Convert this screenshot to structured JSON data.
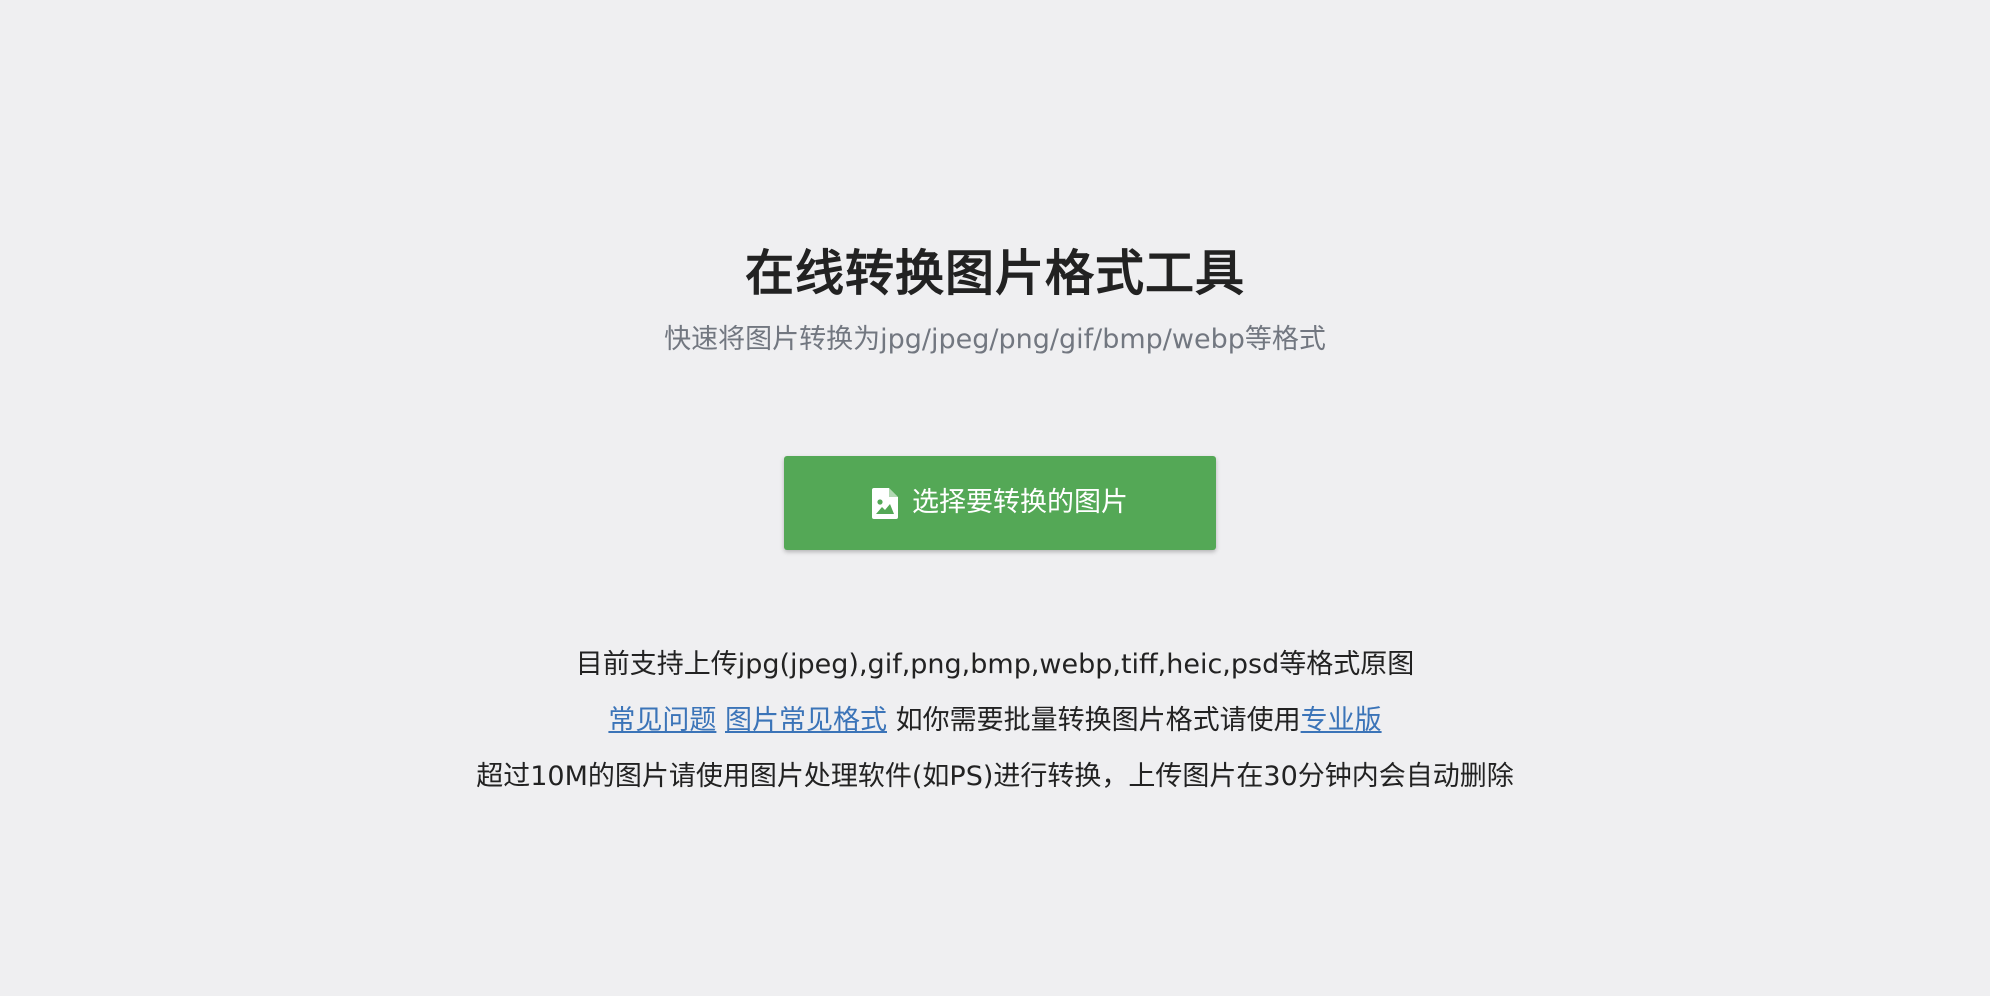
{
  "header": {
    "title": "在线转换图片格式工具",
    "subtitle": "快速将图片转换为jpg/jpeg/png/gif/bmp/webp等格式"
  },
  "upload": {
    "button_label": "选择要转换的图片",
    "icon": "file-image-icon",
    "color": "#54a856"
  },
  "info": {
    "supported_formats": "目前支持上传jpg(jpeg),gif,png,bmp,webp,tiff,heic,psd等格式原图",
    "faq_link": "常见问题",
    "formats_link": "图片常见格式",
    "batch_text": "如你需要批量转换图片格式请使用",
    "pro_link": "专业版",
    "size_notice": "超过10M的图片请使用图片处理软件(如PS)进行转换，上传图片在30分钟内会自动删除"
  },
  "colors": {
    "background": "#efeff1",
    "link": "#3b74b8"
  }
}
